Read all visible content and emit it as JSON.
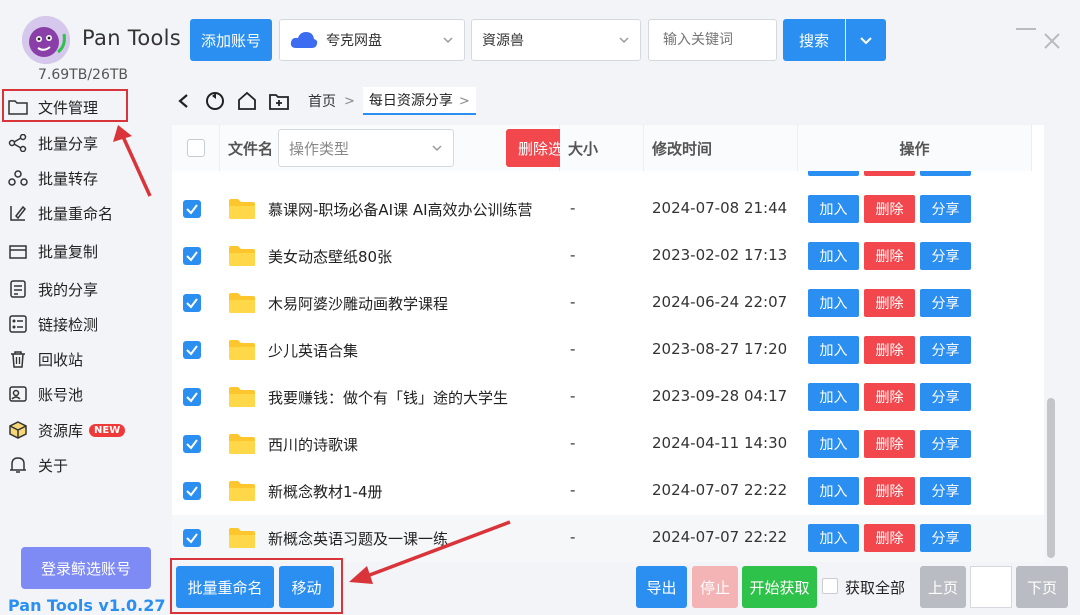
{
  "app": {
    "name": "Pan Tools",
    "storage": "7.69TB/26TB",
    "version": "Pan Tools v1.0.27"
  },
  "toolbar": {
    "add_account": "添加账号",
    "cloud_select": "夸克网盘",
    "source_select": "資源兽",
    "search_placeholder": "输入关键词",
    "search_button": "搜索"
  },
  "sidebar": {
    "items": [
      {
        "label": "文件管理",
        "icon": "folder-icon"
      },
      {
        "label": "批量分享",
        "icon": "share-icon"
      },
      {
        "label": "批量转存",
        "icon": "transfer-icon"
      },
      {
        "label": "批量重命名",
        "icon": "rename-icon"
      },
      {
        "label": "批量复制",
        "icon": "copy-icon"
      },
      {
        "label": "我的分享",
        "icon": "my-share-icon"
      },
      {
        "label": "链接检测",
        "icon": "link-check-icon"
      },
      {
        "label": "回收站",
        "icon": "trash-icon"
      },
      {
        "label": "账号池",
        "icon": "account-pool-icon"
      },
      {
        "label": "资源库",
        "icon": "box-icon",
        "badge": "NEW"
      },
      {
        "label": "关于",
        "icon": "bell-icon"
      }
    ],
    "login_button": "登录鲸选账号"
  },
  "breadcrumb": {
    "home": "首页",
    "current": "每日资源分享"
  },
  "table": {
    "headers": {
      "name": "文件名",
      "op_type_placeholder": "操作类型",
      "delete_selected": "删除选中",
      "size": "大小",
      "modified": "修改时间",
      "actions": "操作"
    },
    "row_actions": {
      "add": "加入",
      "delete": "删除",
      "share": "分享"
    },
    "rows": [
      {
        "name": "慕课网-职场必备AI课 AI高效办公训练营",
        "size": "-",
        "modified": "2024-07-08 21:44",
        "checked": true
      },
      {
        "name": "美女动态壁纸80张",
        "size": "-",
        "modified": "2023-02-02 17:13",
        "checked": true
      },
      {
        "name": "木易阿婆沙雕动画教学课程",
        "size": "-",
        "modified": "2024-06-24 22:07",
        "checked": true
      },
      {
        "name": "少儿英语合集",
        "size": "-",
        "modified": "2023-08-27 17:20",
        "checked": true
      },
      {
        "name": "我要赚钱：做个有「钱」途的大学生",
        "size": "-",
        "modified": "2023-09-28 04:17",
        "checked": true
      },
      {
        "name": "西川的诗歌课",
        "size": "-",
        "modified": "2024-04-11 14:30",
        "checked": true
      },
      {
        "name": "新概念教材1-4册",
        "size": "-",
        "modified": "2024-07-07 22:22",
        "checked": true
      },
      {
        "name": "新概念英语习题及一课一练",
        "size": "-",
        "modified": "2024-07-07 22:22",
        "checked": true
      }
    ]
  },
  "bottom": {
    "batch_rename": "批量重命名",
    "move": "移动",
    "export": "导出",
    "stop": "停止",
    "start_fetch": "开始获取",
    "fetch_all": "获取全部",
    "prev_page": "上页",
    "next_page": "下页"
  },
  "colors": {
    "primary": "#2a8ff0",
    "danger": "#f2474d",
    "success": "#2ec24a",
    "annotation": "#d9343a"
  }
}
